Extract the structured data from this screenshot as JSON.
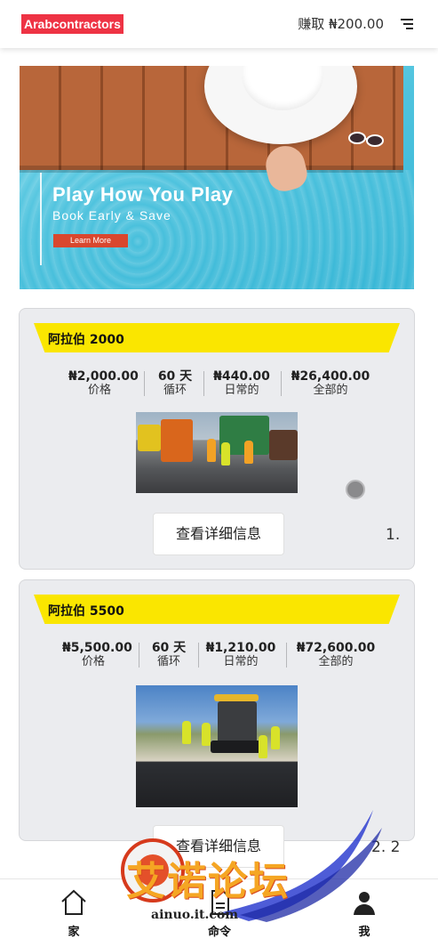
{
  "header": {
    "logo_text": "Arabcontractors",
    "earn_text": "赚取 ₦200.00",
    "menu_icon": "menu-icon"
  },
  "banner": {
    "title": "Play How You Play",
    "subtitle": "Book Early & Save",
    "button_label": "Learn More"
  },
  "plans": [
    {
      "name": "阿拉伯 2000",
      "price_value": "₦2,000.00",
      "price_label": "价格",
      "cycle_value": "60 天",
      "cycle_label": "循环",
      "daily_value": "₦440.00",
      "daily_label": "日常的",
      "total_value": "₦26,400.00",
      "total_label": "全部的",
      "button_label": "查看详细信息",
      "index": "1."
    },
    {
      "name": "阿拉伯 5500",
      "price_value": "₦5,500.00",
      "price_label": "价格",
      "cycle_value": "60 天",
      "cycle_label": "循环",
      "daily_value": "₦1,210.00",
      "daily_label": "日常的",
      "total_value": "₦72,600.00",
      "total_label": "全部的",
      "button_label": "查看详细信息",
      "index": "2. 2"
    }
  ],
  "bottom_nav": {
    "items": [
      {
        "label": "家",
        "icon": "home-icon"
      },
      {
        "label": "命令",
        "icon": "document-icon"
      },
      {
        "label": "我",
        "icon": "user-icon"
      }
    ]
  },
  "watermark": {
    "text": "艾诺论坛",
    "url": "ainuo.it.com"
  }
}
